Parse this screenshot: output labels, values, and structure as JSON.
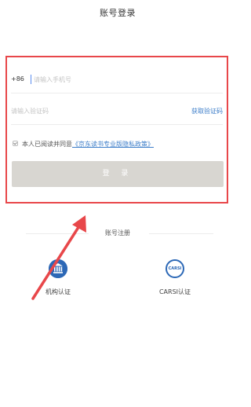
{
  "title": "账号登录",
  "phone": {
    "country_code": "+86",
    "placeholder": "请输入手机号"
  },
  "verify_code": {
    "placeholder": "请输入验证码",
    "get_code_label": "获取验证码"
  },
  "agreement": {
    "text": "本人已阅读并同意",
    "link_text": "《京东读书专业版隐私政策》"
  },
  "login_button_label": "登 录",
  "register": {
    "label": "账号注册",
    "methods": [
      {
        "label": "机构认证",
        "icon": "institution-icon"
      },
      {
        "label": "CARSI认证",
        "icon": "carsi-icon",
        "icon_text": "CARSI"
      }
    ]
  },
  "colors": {
    "highlight": "#e8474a",
    "link": "#3d7ec9",
    "icon_blue": "#2c68b6",
    "button_bg": "#d8d6d1"
  }
}
